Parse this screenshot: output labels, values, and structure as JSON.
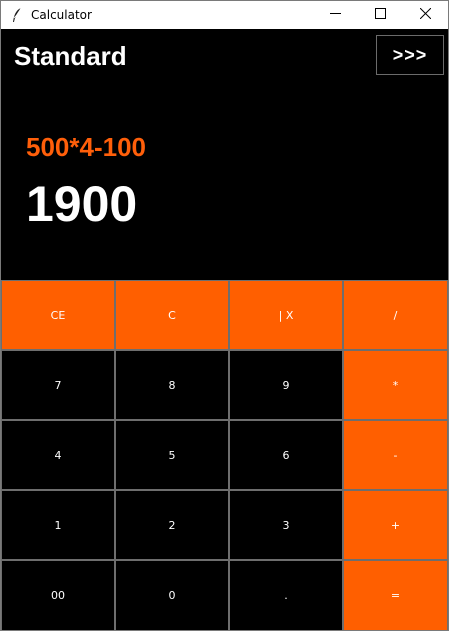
{
  "window": {
    "title": "Calculator",
    "controls": [
      "minimize",
      "maximize",
      "close"
    ]
  },
  "header": {
    "mode": "Standard",
    "expand_label": ">>>"
  },
  "display": {
    "expression": "500*4-100",
    "result": "1900"
  },
  "keypad": {
    "rows": [
      [
        "CE",
        "C",
        "| X",
        "/"
      ],
      [
        "7",
        "8",
        "9",
        "*"
      ],
      [
        "4",
        "5",
        "6",
        "-"
      ],
      [
        "1",
        "2",
        "3",
        "+"
      ],
      [
        "00",
        "0",
        ".",
        "="
      ]
    ]
  },
  "colors": {
    "accent": "#ff5f00",
    "expression": "#ff5f0a",
    "background": "#000000",
    "text": "#ffffff"
  }
}
